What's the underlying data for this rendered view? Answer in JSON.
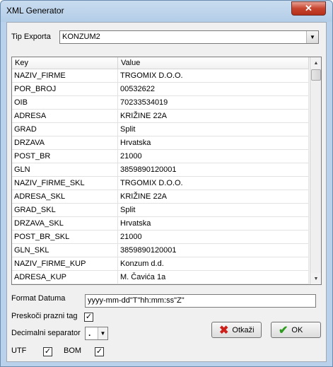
{
  "window": {
    "title": "XML Generator",
    "close_glyph": "✕"
  },
  "export": {
    "label": "Tip Exporta",
    "value": "KONZUM2"
  },
  "grid": {
    "columns": [
      "Key",
      "Value"
    ],
    "rows": [
      {
        "key": "NAZIV_FIRME",
        "value": "TRGOMIX D.O.O."
      },
      {
        "key": "POR_BROJ",
        "value": "00532622"
      },
      {
        "key": "OIB",
        "value": "70233534019"
      },
      {
        "key": "ADRESA",
        "value": "KRIŽINE 22A"
      },
      {
        "key": "GRAD",
        "value": "Split"
      },
      {
        "key": "DRZAVA",
        "value": "Hrvatska"
      },
      {
        "key": "POST_BR",
        "value": "21000"
      },
      {
        "key": "GLN",
        "value": "3859890120001"
      },
      {
        "key": "NAZIV_FIRME_SKL",
        "value": "TRGOMIX D.O.O."
      },
      {
        "key": "ADRESA_SKL",
        "value": "KRIŽINE 22A"
      },
      {
        "key": "GRAD_SKL",
        "value": "Split"
      },
      {
        "key": "DRZAVA_SKL",
        "value": "Hrvatska"
      },
      {
        "key": "POST_BR_SKL",
        "value": "21000"
      },
      {
        "key": "GLN_SKL",
        "value": "3859890120001"
      },
      {
        "key": "NAZIV_FIRME_KUP",
        "value": "Konzum d.d."
      },
      {
        "key": "ADRESA_KUP",
        "value": "M. Čavića 1a"
      }
    ]
  },
  "format": {
    "label": "Format Datuma",
    "value": "yyyy-mm-dd\"T\"hh:mm:ss\"Z\""
  },
  "skip_empty": {
    "label": "Preskoči prazni tag",
    "checked": "✓"
  },
  "decimal": {
    "label": "Decimalni separator",
    "value": "."
  },
  "utf": {
    "label": "UTF",
    "checked": "✓"
  },
  "bom": {
    "label": "BOM",
    "checked": "✓"
  },
  "buttons": {
    "cancel_label": "Otkaži",
    "ok_label": "OK",
    "cancel_icon": "✖",
    "ok_icon": "✔"
  },
  "colors": {
    "cancel_icon": "#cc1f1a",
    "ok_icon": "#2e9a1f"
  }
}
